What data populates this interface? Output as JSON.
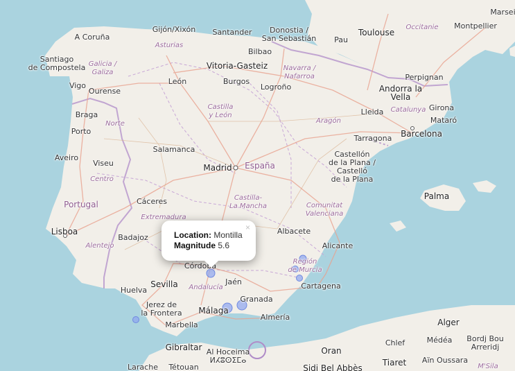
{
  "map": {
    "colors": {
      "sea": "#aad3df",
      "land": "#f2efe9",
      "border": "#b08cc8",
      "road": "#e9a28f",
      "marker": "#8da5ef"
    },
    "labels": {
      "a_coruna": "A Coruña",
      "gijon": "Gijón/Xixón",
      "santander": "Santander",
      "donostia": "Donostia /\nSan Sebastián",
      "toulouse": "Toulouse",
      "occitanie": "Occitanie",
      "montpellier": "Montpellier",
      "marseille": "Marseil",
      "santiago": "Santiago\nde Compostela",
      "galicia": "Galicia /\nGaliza",
      "asturias": "Asturias",
      "bilbao": "Bilbao",
      "pau": "Pau",
      "vitoria": "Vitoria-Gasteiz",
      "navarra": "Navarra /\nNafarroa",
      "vigo": "Vigo",
      "ourense": "Ourense",
      "leon": "León",
      "burgos": "Burgos",
      "logrono": "Logroño",
      "perpignan": "Perpignan",
      "andorra": "Andorra la\nVella",
      "castilla_leon": "Castilla\ny León",
      "braga": "Braga",
      "lleida": "Lleida",
      "catalunya": "Catalunya",
      "girona": "Girona",
      "porto": "Porto",
      "norte": "Norte",
      "aragon": "Aragón",
      "mataro": "Mataró",
      "barcelona": "Barcelona",
      "salamanca": "Salamanca",
      "tarragona": "Tarragona",
      "aveiro": "Aveiro",
      "viseu": "Viseu",
      "castellon": "Castellón\nde la Plana /\nCastelló\nde la Plana",
      "madrid": "Madrid",
      "espana": "España",
      "centro": "Centro",
      "palma": "Palma",
      "portugal": "Portugal",
      "castilla_mancha": "Castilla-\nLa Mancha",
      "caceres": "Cáceres",
      "comunitat": "Comunitat\nValenciana",
      "extremadura": "Extremadura",
      "lisboa": "Lisboa",
      "badajoz": "Badajoz",
      "albacete": "Albacete",
      "alentejo": "Alentejo",
      "alicante": "Alicante",
      "cordoba": "Córdoba",
      "murcia_region": "Región\nde Murcia",
      "sevilla": "Sevilla",
      "jaen": "Jaén",
      "andalucia": "Andalucía",
      "huelva": "Huelva",
      "cartagena": "Cartagena",
      "jerez": "Jerez de\nla Frontera",
      "granada": "Granada",
      "malaga": "Málaga",
      "almeria": "Almería",
      "marbella": "Marbella",
      "alger": "Alger",
      "gibraltar": "Gibraltar",
      "medea": "Médéa",
      "bordj": "Bordj Bou\nArreridj",
      "chlef": "Chlef",
      "al_hoceima": "Al Hoceima\nⵍⵃⵓⵙⵉⵎⴰ",
      "oran": "Oran",
      "tiaret": "Tiaret",
      "ain_oussara": "Aïn Oussara",
      "msila": "M'Sila",
      "larache": "Larache",
      "tetouan": "Tétouan",
      "sidi_bel_abbes": "Sidi Bel Abbès"
    },
    "markers": [
      {
        "name": "Montilla",
        "magnitude": 5.6
      }
    ]
  },
  "popup": {
    "location_label": "Location:",
    "location_value": "Montilla",
    "magnitude_label": "Magnitude",
    "magnitude_value": "5.6",
    "close_glyph": "×"
  }
}
